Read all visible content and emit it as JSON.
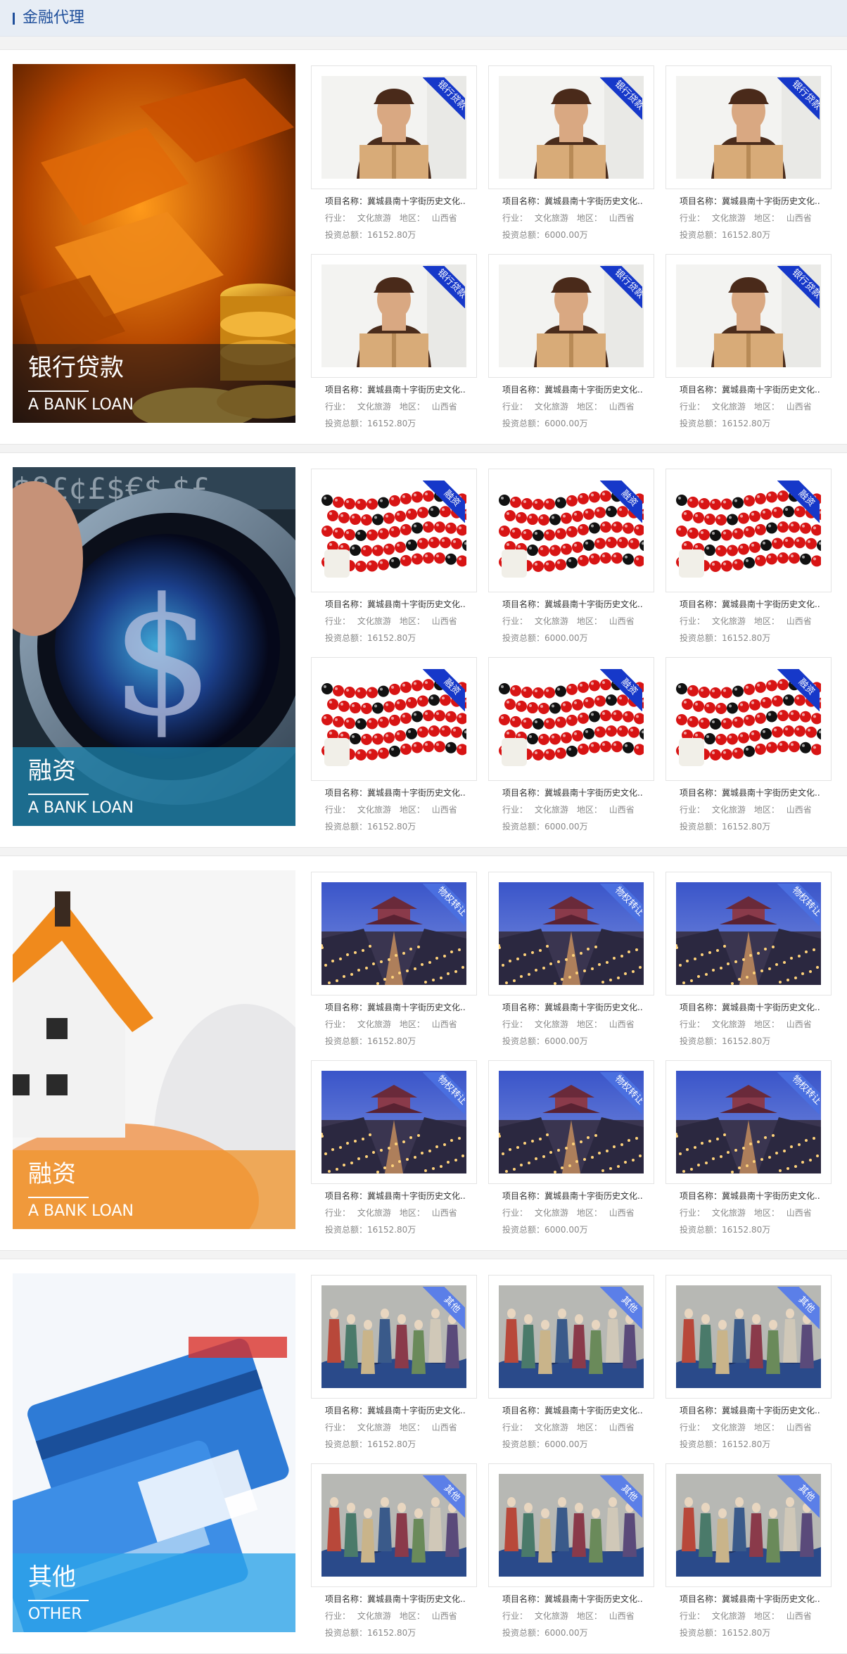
{
  "header": {
    "title": "金融代理"
  },
  "item_labels": {
    "name_prefix": "项目名称：",
    "industry_prefix": "行业：",
    "region_prefix": "地区：",
    "amount_prefix": "投资总额："
  },
  "sections": [
    {
      "title_cn": "银行贷款",
      "title_en": "A BANK LOAN",
      "overlay_color": "#1a1a1a",
      "tag": "银行贷款",
      "tag_color": "#1638c9",
      "image_kind": "delivery",
      "items": [
        {
          "name": "冀城县南十字街历史文化...",
          "industry": "文化旅游",
          "region": "山西省",
          "amount": "16152.80万"
        },
        {
          "name": "冀城县南十字街历史文化...",
          "industry": "文化旅游",
          "region": "山西省",
          "amount": "6000.00万"
        },
        {
          "name": "冀城县南十字街历史文化...",
          "industry": "文化旅游",
          "region": "山西省",
          "amount": "16152.80万"
        },
        {
          "name": "冀城县南十字街历史文化...",
          "industry": "文化旅游",
          "region": "山西省",
          "amount": "16152.80万"
        },
        {
          "name": "冀城县南十字街历史文化...",
          "industry": "文化旅游",
          "region": "山西省",
          "amount": "6000.00万"
        },
        {
          "name": "冀城县南十字街历史文化...",
          "industry": "文化旅游",
          "region": "山西省",
          "amount": "16152.80万"
        }
      ]
    },
    {
      "title_cn": "融资",
      "title_en": "A BANK LOAN",
      "overlay_color": "#1c7fa8",
      "tag": "融资",
      "tag_color": "#1638c9",
      "image_kind": "beads",
      "items": [
        {
          "name": "冀城县南十字街历史文化...",
          "industry": "文化旅游",
          "region": "山西省",
          "amount": "16152.80万"
        },
        {
          "name": "冀城县南十字街历史文化...",
          "industry": "文化旅游",
          "region": "山西省",
          "amount": "6000.00万"
        },
        {
          "name": "冀城县南十字街历史文化...",
          "industry": "文化旅游",
          "region": "山西省",
          "amount": "16152.80万"
        },
        {
          "name": "冀城县南十字街历史文化...",
          "industry": "文化旅游",
          "region": "山西省",
          "amount": "16152.80万"
        },
        {
          "name": "冀城县南十字街历史文化...",
          "industry": "文化旅游",
          "region": "山西省",
          "amount": "6000.00万"
        },
        {
          "name": "冀城县南十字街历史文化...",
          "industry": "文化旅游",
          "region": "山西省",
          "amount": "16152.80万"
        }
      ]
    },
    {
      "title_cn": "融资",
      "title_en": "A BANK LOAN",
      "overlay_color": "#f0962e",
      "tag": "物权转让",
      "tag_color": "#4a6fe0",
      "image_kind": "town",
      "items": [
        {
          "name": "冀城县南十字街历史文化...",
          "industry": "文化旅游",
          "region": "山西省",
          "amount": "16152.80万"
        },
        {
          "name": "冀城县南十字街历史文化...",
          "industry": "文化旅游",
          "region": "山西省",
          "amount": "6000.00万"
        },
        {
          "name": "冀城县南十字街历史文化...",
          "industry": "文化旅游",
          "region": "山西省",
          "amount": "16152.80万"
        },
        {
          "name": "冀城县南十字街历史文化...",
          "industry": "文化旅游",
          "region": "山西省",
          "amount": "16152.80万"
        },
        {
          "name": "冀城县南十字街历史文化...",
          "industry": "文化旅游",
          "region": "山西省",
          "amount": "6000.00万"
        },
        {
          "name": "冀城县南十字街历史文化...",
          "industry": "文化旅游",
          "region": "山西省",
          "amount": "16152.80万"
        }
      ]
    },
    {
      "title_cn": "其他",
      "title_en": "OTHER",
      "overlay_color": "#2aa3e8",
      "tag": "其他",
      "tag_color": "#5b7fe8",
      "image_kind": "figurines",
      "items": [
        {
          "name": "冀城县南十字街历史文化...",
          "industry": "文化旅游",
          "region": "山西省",
          "amount": "16152.80万"
        },
        {
          "name": "冀城县南十字街历史文化...",
          "industry": "文化旅游",
          "region": "山西省",
          "amount": "6000.00万"
        },
        {
          "name": "冀城县南十字街历史文化...",
          "industry": "文化旅游",
          "region": "山西省",
          "amount": "16152.80万"
        },
        {
          "name": "冀城县南十字街历史文化...",
          "industry": "文化旅游",
          "region": "山西省",
          "amount": "16152.80万"
        },
        {
          "name": "冀城县南十字街历史文化...",
          "industry": "文化旅游",
          "region": "山西省",
          "amount": "6000.00万"
        },
        {
          "name": "冀城县南十字街历史文化...",
          "industry": "文化旅游",
          "region": "山西省",
          "amount": "16152.80万"
        }
      ]
    }
  ]
}
